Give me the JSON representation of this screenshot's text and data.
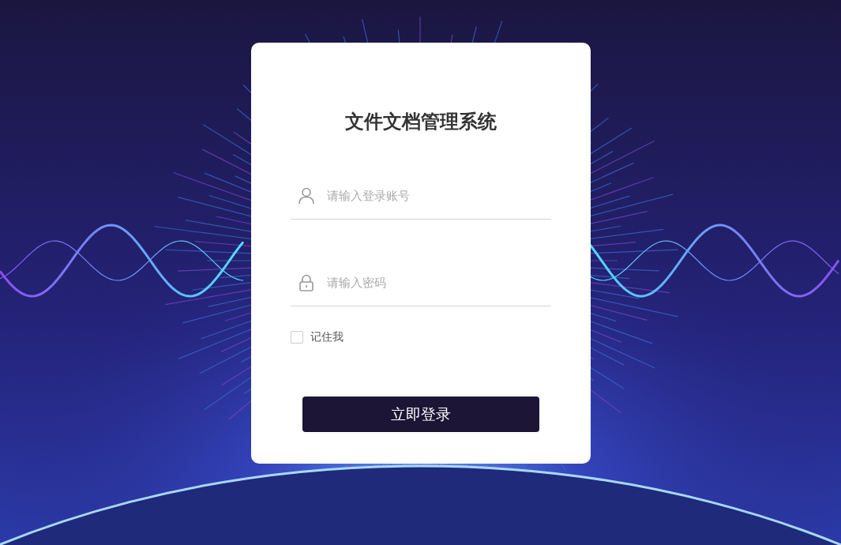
{
  "login_card": {
    "title": "文件文档管理系统",
    "fields": [
      {
        "kind": "user",
        "placeholder": "请输入登录账号"
      },
      {
        "kind": "password",
        "placeholder": "请输入密码"
      }
    ],
    "remember_me": {
      "label": "记住我",
      "checked": false
    },
    "submit_button": {
      "label": "立即登录"
    }
  }
}
